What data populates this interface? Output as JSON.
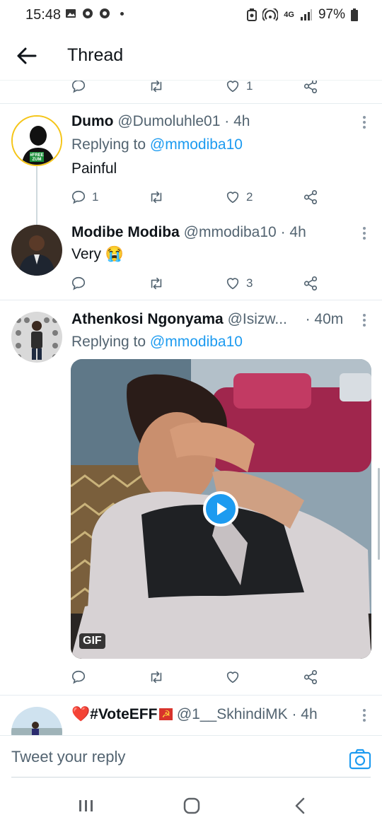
{
  "status_bar": {
    "time": "15:48",
    "battery": "97%",
    "network": "4G"
  },
  "header": {
    "title": "Thread"
  },
  "top_actions": {
    "like_count": "1"
  },
  "tweets": [
    {
      "name": "Dumo",
      "handle": "@Dumoluhle01",
      "sep": "·",
      "time": "4h",
      "replying_prefix": "Replying to",
      "replying_to": "@mmodiba10",
      "text": "Painful",
      "reply_count": "1",
      "retweet_count": "",
      "like_count": "2"
    },
    {
      "name": "Modibe Modiba",
      "handle": "@mmodiba10",
      "sep": "·",
      "time": "4h",
      "text": "Very 😭",
      "reply_count": "",
      "retweet_count": "",
      "like_count": "3"
    },
    {
      "name": "Athenkosi Ngonyama",
      "handle": "@Isizw...",
      "sep": "·",
      "time": "40m",
      "replying_prefix": "Replying to",
      "replying_to": "@mmodiba10",
      "media_badge": "GIF",
      "reply_count": "",
      "retweet_count": "",
      "like_count": ""
    },
    {
      "name": "#VoteEFF",
      "name_emoji_before": "❤️",
      "name_emoji_after": "☭",
      "handle": "@1__SkhindiMK",
      "sep": "·",
      "time": "4h"
    }
  ],
  "composer": {
    "placeholder": "Tweet your reply"
  },
  "colors": {
    "accent": "#1d9bf0",
    "text": "#0f1419",
    "secondary": "#536471"
  }
}
